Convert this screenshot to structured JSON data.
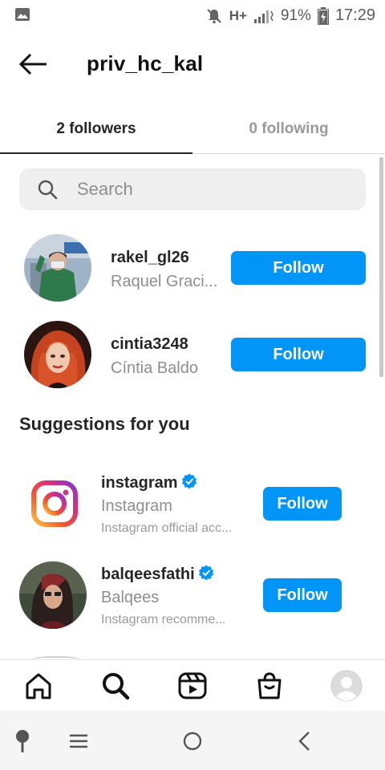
{
  "status_bar": {
    "network": "H+",
    "battery": "91%",
    "time": "17:29"
  },
  "header": {
    "title": "priv_hc_kal"
  },
  "tabs": [
    {
      "label": "2 followers",
      "active": true
    },
    {
      "label": "0 following",
      "active": false
    }
  ],
  "search": {
    "placeholder": "Search"
  },
  "followers": [
    {
      "username": "rakel_gl26",
      "full_name": "Raquel Graci...",
      "button": "Follow"
    },
    {
      "username": "cintia3248",
      "full_name": "Cíntia Baldo",
      "button": "Follow"
    }
  ],
  "suggestions": {
    "title": "Suggestions for you",
    "items": [
      {
        "username": "instagram",
        "full_name": "Instagram",
        "subtitle": "Instagram official acc...",
        "verified": true,
        "button": "Follow"
      },
      {
        "username": "balqeesfathi",
        "full_name": "Balqees",
        "subtitle": "Instagram recomme...",
        "verified": true,
        "button": "Follow"
      }
    ]
  },
  "bottom_nav": [
    "home-icon",
    "search-icon",
    "reels-icon",
    "shop-icon",
    "profile-icon"
  ],
  "colors": {
    "accent": "#0095f6",
    "text": "#262626",
    "muted": "#8e8e8e"
  }
}
